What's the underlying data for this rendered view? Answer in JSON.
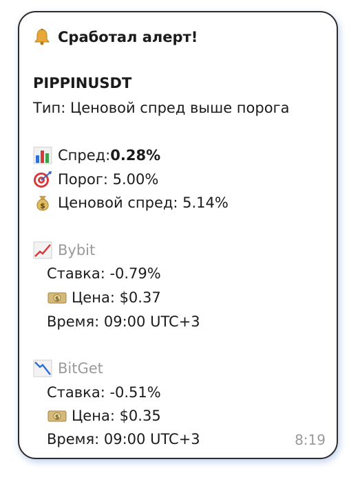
{
  "message": {
    "header": "Сработал алерт!",
    "symbol": "PIPPINUSDT",
    "type_line": "Тип: Ценовой спред выше порога",
    "spread_label": "Спред: ",
    "spread_value": "0.28%",
    "threshold_line": "Порог: 5.00%",
    "price_spread_line": "Ценовой спред: 5.14%",
    "exchanges": [
      {
        "name": "Bybit",
        "rate": "Ставка: -0.79%",
        "price": "Цена: $0.37",
        "time": "Время: 09:00 UTC+3"
      },
      {
        "name": "BitGet",
        "rate": "Ставка: -0.51%",
        "price": "Цена: $0.35",
        "time": "Время: 09:00 UTC+3"
      }
    ],
    "timestamp": "8:19"
  },
  "icons": {
    "header": "bell-icon",
    "spread": "bar-chart-icon",
    "threshold": "target-dart-icon",
    "price_spread": "money-bag-icon",
    "bybit": "chart-up-icon",
    "bitget": "chart-down-icon",
    "price": "banknote-icon"
  }
}
